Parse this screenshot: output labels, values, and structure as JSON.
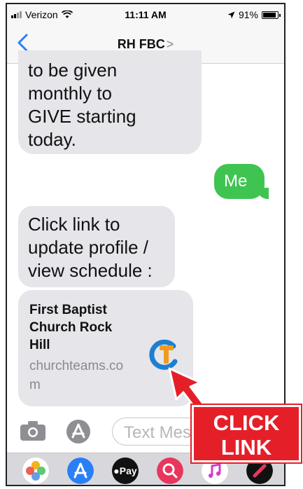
{
  "status_bar": {
    "carrier": "Verizon",
    "time": "11:11 AM",
    "battery": "91%",
    "battery_level": 0.91
  },
  "nav": {
    "title": "RH FBC",
    "title_chevron": ">"
  },
  "messages": [
    {
      "text_lines": [
        "to be given",
        "monthly to",
        "GIVE starting",
        "today."
      ]
    },
    {
      "text": "Me"
    },
    {
      "text_lines": [
        "Click link to",
        "update profile /",
        "view schedule :"
      ]
    }
  ],
  "link_preview": {
    "title_lines": [
      "First Baptist",
      "Church Rock",
      "Hill"
    ],
    "domain_lines": [
      "churchteams.co",
      "m"
    ]
  },
  "input": {
    "placeholder": "Text Mes"
  },
  "drawer": {
    "apple_pay_label": "Pay"
  },
  "callout": {
    "line1": "CLICK",
    "line2": "LINK"
  },
  "colors": {
    "sent_bubble": "#3fc451",
    "received_bubble": "#e5e5ea",
    "ios_blue": "#2a7ff6",
    "callout_red": "#e51f28"
  }
}
